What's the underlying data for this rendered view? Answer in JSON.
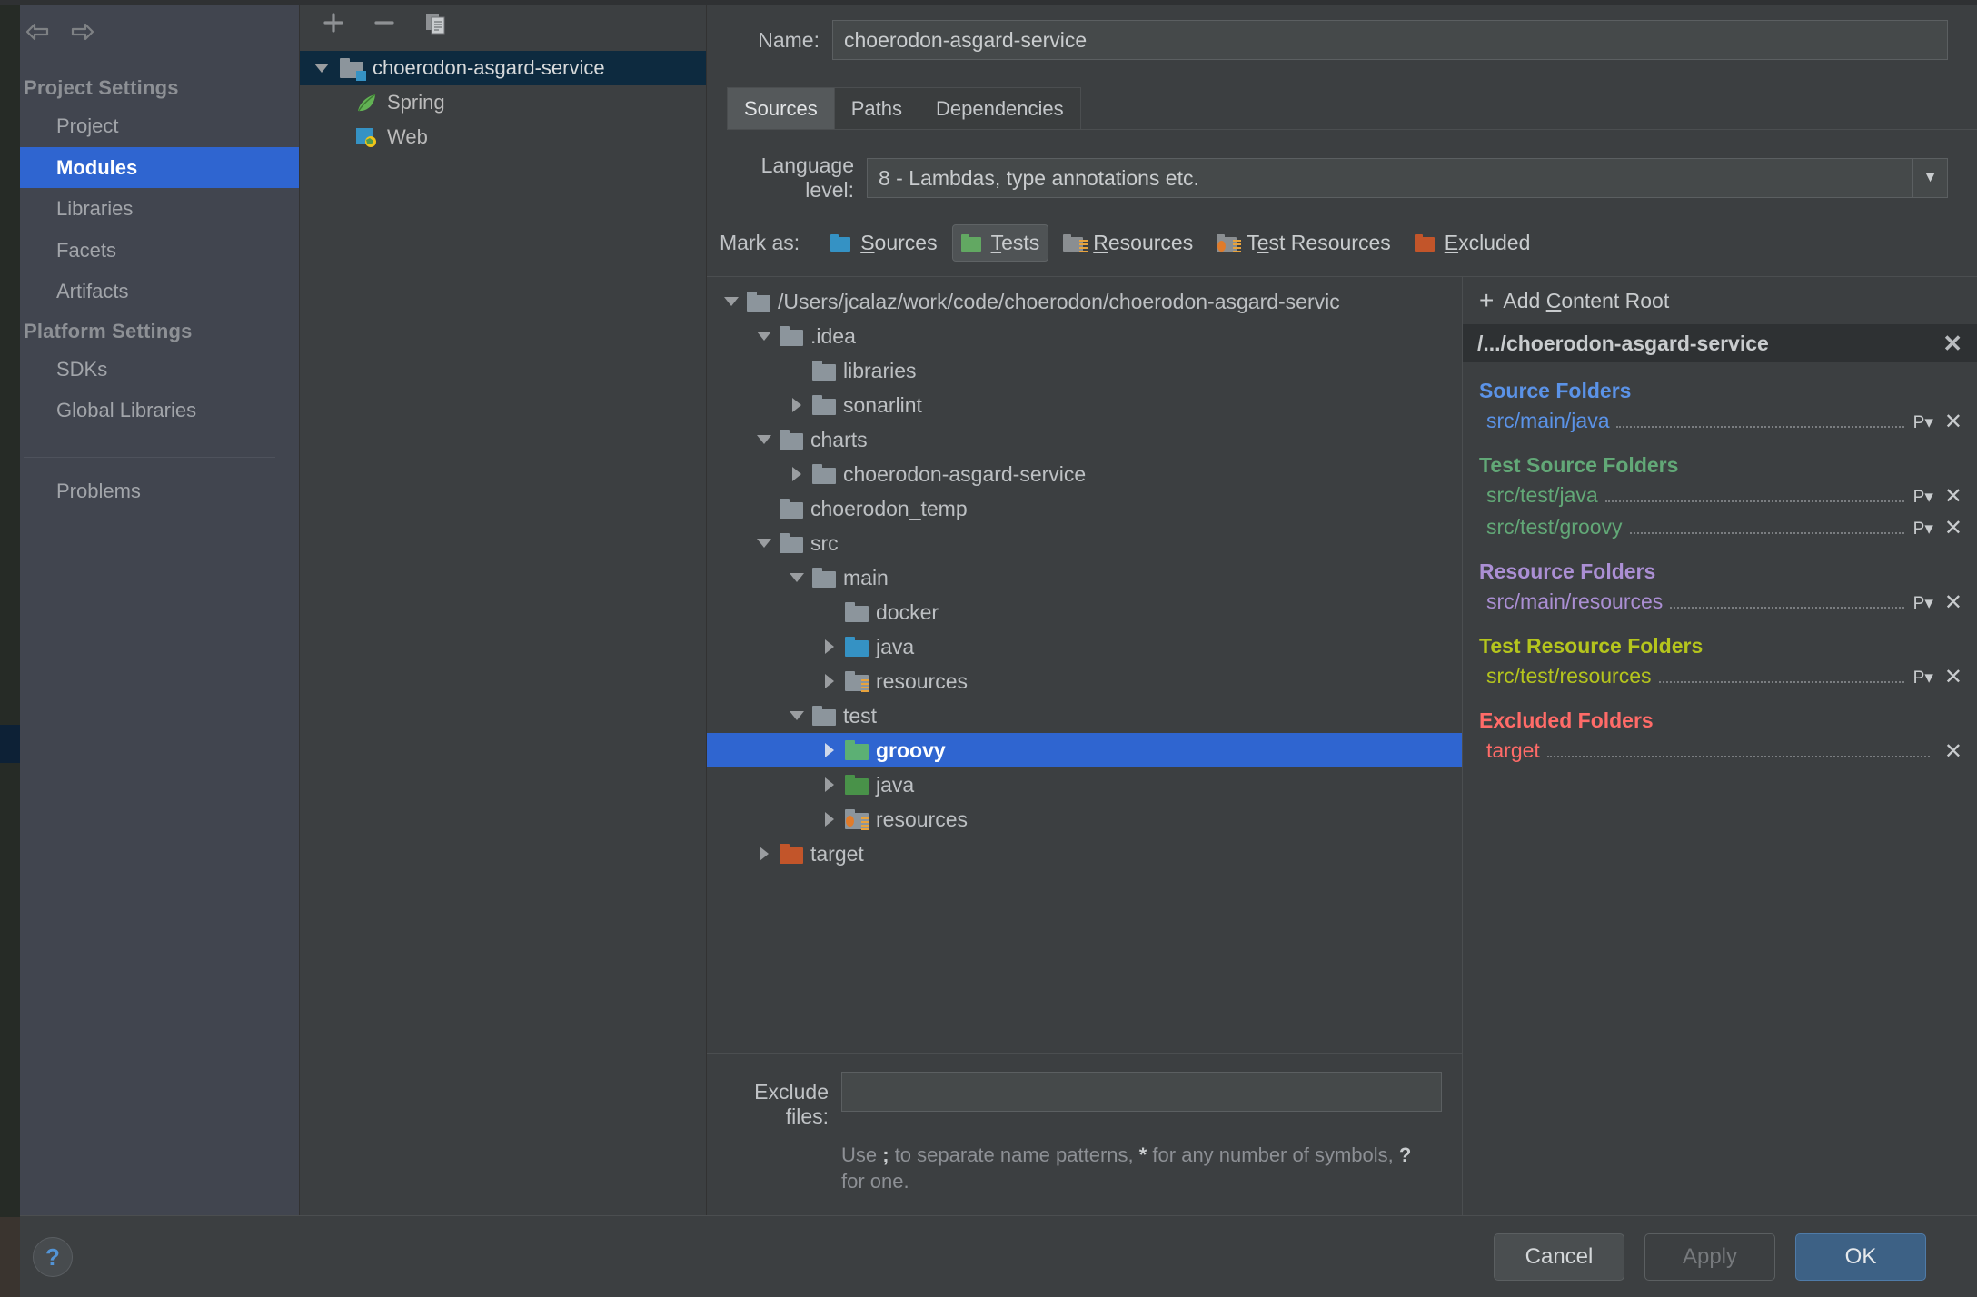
{
  "sidebar": {
    "nav": {
      "back_icon": "arrow-left-icon",
      "forward_icon": "arrow-right-icon"
    },
    "groups": [
      {
        "title": "Project Settings",
        "items": [
          {
            "label": "Project",
            "selected": false
          },
          {
            "label": "Modules",
            "selected": true
          },
          {
            "label": "Libraries",
            "selected": false
          },
          {
            "label": "Facets",
            "selected": false
          },
          {
            "label": "Artifacts",
            "selected": false
          }
        ]
      },
      {
        "title": "Platform Settings",
        "items": [
          {
            "label": "SDKs",
            "selected": false
          },
          {
            "label": "Global Libraries",
            "selected": false
          }
        ]
      }
    ],
    "problems_label": "Problems",
    "help_label": "?"
  },
  "module_panel": {
    "toolbar": [
      {
        "name": "add-module-button",
        "icon": "plus-icon"
      },
      {
        "name": "remove-module-button",
        "icon": "minus-icon"
      },
      {
        "name": "copy-module-button",
        "icon": "copy-icon"
      }
    ],
    "tree": [
      {
        "label": "choerodon-asgard-service",
        "icon": "module-folder-icon",
        "twisty": "down",
        "depth": 0,
        "selected": true
      },
      {
        "label": "Spring",
        "icon": "spring-leaf-icon",
        "twisty": "none",
        "depth": 1,
        "selected": false
      },
      {
        "label": "Web",
        "icon": "web-globe-icon",
        "twisty": "none",
        "depth": 1,
        "selected": false
      }
    ]
  },
  "main": {
    "name_label": "Name:",
    "name_value": "choerodon-asgard-service",
    "tabs": [
      {
        "label": "Sources",
        "active": true
      },
      {
        "label": "Paths",
        "active": false
      },
      {
        "label": "Dependencies",
        "active": false
      }
    ],
    "language_level_label": "Language level:",
    "language_level_value": "8 - Lambdas, type annotations etc.",
    "mark_as_label": "Mark as:",
    "mark_as_buttons": [
      {
        "label": "Sources",
        "mnemonic": "S",
        "icon": "folder-sources-icon",
        "pressed": false,
        "color": "#3592c4"
      },
      {
        "label": "Tests",
        "mnemonic": "T",
        "icon": "folder-tests-icon",
        "pressed": true,
        "color": "#62a862"
      },
      {
        "label": "Resources",
        "mnemonic": "R",
        "icon": "folder-resources-icon",
        "pressed": false,
        "color": "#8a8e91"
      },
      {
        "label": "Test Resources",
        "mnemonic": "e",
        "icon": "folder-test-resources-icon",
        "pressed": false,
        "color": "#8a8e91"
      },
      {
        "label": "Excluded",
        "mnemonic": "E",
        "icon": "folder-excluded-icon",
        "pressed": false,
        "color": "#c2552a"
      }
    ],
    "exclude_files_label": "Exclude files:",
    "exclude_files_value": "",
    "exclude_hint_1": "Use ",
    "exclude_hint_sep": ";",
    "exclude_hint_2": " to separate name patterns, ",
    "exclude_hint_star": "*",
    "exclude_hint_3": " for any number of symbols, ",
    "exclude_hint_q": "?",
    "exclude_hint_4": " for one."
  },
  "file_tree": [
    {
      "label": "/Users/jcalaz/work/code/choerodon/choerodon-asgard-servic",
      "depth": 0,
      "twisty": "down",
      "folder": "plain",
      "selected": false
    },
    {
      "label": ".idea",
      "depth": 1,
      "twisty": "down",
      "folder": "plain",
      "selected": false
    },
    {
      "label": "libraries",
      "depth": 2,
      "twisty": "none",
      "folder": "plain",
      "selected": false
    },
    {
      "label": "sonarlint",
      "depth": 2,
      "twisty": "right",
      "folder": "plain",
      "selected": false
    },
    {
      "label": "charts",
      "depth": 1,
      "twisty": "down",
      "folder": "plain",
      "selected": false
    },
    {
      "label": "choerodon-asgard-service",
      "depth": 2,
      "twisty": "right",
      "folder": "plain",
      "selected": false
    },
    {
      "label": "choerodon_temp",
      "depth": 1,
      "twisty": "none",
      "folder": "plain",
      "selected": false
    },
    {
      "label": "src",
      "depth": 1,
      "twisty": "down",
      "folder": "plain",
      "selected": false
    },
    {
      "label": "main",
      "depth": 2,
      "twisty": "down",
      "folder": "plain",
      "selected": false
    },
    {
      "label": "docker",
      "depth": 3,
      "twisty": "none",
      "folder": "plain",
      "selected": false
    },
    {
      "label": "java",
      "depth": 3,
      "twisty": "right",
      "folder": "sources",
      "selected": false
    },
    {
      "label": "resources",
      "depth": 3,
      "twisty": "right",
      "folder": "resources",
      "selected": false
    },
    {
      "label": "test",
      "depth": 2,
      "twisty": "down",
      "folder": "plain",
      "selected": false
    },
    {
      "label": "groovy",
      "depth": 3,
      "twisty": "right",
      "folder": "tests",
      "selected": true
    },
    {
      "label": "java",
      "depth": 3,
      "twisty": "right",
      "folder": "tests",
      "selected": false
    },
    {
      "label": "resources",
      "depth": 3,
      "twisty": "right",
      "folder": "testres",
      "selected": false
    },
    {
      "label": "target",
      "depth": 1,
      "twisty": "right",
      "folder": "excluded",
      "selected": false
    }
  ],
  "roots_panel": {
    "add_content_root_label": "Add Content Root",
    "add_content_root_mnemonic": "C",
    "content_root_path": "/.../choerodon-asgard-service",
    "content_root_remove_icon": "close-icon",
    "groups": [
      {
        "title": "Source Folders",
        "color": "#5b93e8",
        "items": [
          {
            "path": "src/main/java",
            "has_package_prefix": true
          }
        ]
      },
      {
        "title": "Test Source Folders",
        "color": "#62a877",
        "items": [
          {
            "path": "src/test/java",
            "has_package_prefix": true
          },
          {
            "path": "src/test/groovy",
            "has_package_prefix": true
          }
        ]
      },
      {
        "title": "Resource Folders",
        "color": "#ab8fd4",
        "items": [
          {
            "path": "src/main/resources",
            "has_package_prefix": true
          }
        ]
      },
      {
        "title": "Test Resource Folders",
        "color": "#b5c51d",
        "items": [
          {
            "path": "src/test/resources",
            "has_package_prefix": true
          }
        ]
      },
      {
        "title": "Excluded Folders",
        "color": "#ff6b68",
        "items": [
          {
            "path": "target",
            "has_package_prefix": false
          }
        ]
      }
    ]
  },
  "bottom_bar": {
    "buttons": [
      {
        "label": "Cancel",
        "kind": "normal"
      },
      {
        "label": "Apply",
        "kind": "disabled"
      },
      {
        "label": "OK",
        "kind": "default"
      }
    ]
  },
  "colors": {
    "dialog_bg": "#3c3f41",
    "sidebar_bg": "#41454f",
    "selection_blue": "#2f65d0",
    "tree_selection_navy": "#0d2a3f",
    "default_button_blue": "#3d6185"
  }
}
